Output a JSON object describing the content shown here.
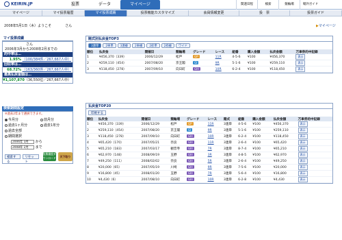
{
  "brand": {
    "logo_text": "KEIRIN.JP"
  },
  "topnav": [
    {
      "label": "投票"
    },
    {
      "label": "データ"
    },
    {
      "label": "マイページ"
    }
  ],
  "util": [
    "関連日程",
    "検索",
    "競輪場",
    "場外ガイド"
  ],
  "subnav": [
    {
      "label": "マイページ"
    },
    {
      "label": "マイ投票履歴"
    },
    {
      "label": "マイ投票成績"
    },
    {
      "label": "投票機能カスタマイズ"
    },
    {
      "label": "会員情報変更"
    },
    {
      "label": "投　票"
    },
    {
      "label": "投票ガイド"
    }
  ],
  "header": {
    "date_line": "2008年5月1日（木）ようこそ　　　　さん",
    "mypage_link": "マイページ"
  },
  "side": {
    "perf_title": "マイ投票成績",
    "perf_name_line": "さん",
    "perf_period": "2006年3月から2008年2月までの",
    "hit_rate_label": "的中率は…",
    "hit_rate_pct": "1.95%",
    "hit_rate_detail": "（100/384件／267,667人中）",
    "return_rate_label": "回収率は…",
    "return_rate_pct": "68.72%",
    "return_rate_detail": "（163/360件／267,667人中）",
    "max_payout_label": "最高払戻金額は…",
    "max_payout_val": "¥1,107,870",
    "max_payout_detail": "（36,550位／267,667人中）",
    "search_title": "検索期間設定",
    "search_note": "※過去2年まで選択できます。",
    "options": [
      {
        "label": "今月分",
        "on": true
      },
      {
        "label": "前月分",
        "on": false
      },
      {
        "label": "過去1ヶ月分",
        "on": false
      },
      {
        "label": "過去1年分",
        "on": false
      },
      {
        "label": "過去全部",
        "on": false
      },
      {
        "label": "期間選択",
        "on": false
      }
    ],
    "from_select": "2006年 3月",
    "until_label": "から",
    "to_select": "2008年 2月",
    "end_label": "まで",
    "btn_search": "検索する",
    "btn_reset": "リセット",
    "banner_label": "投票履歴ダウンロード",
    "banner2_label": "天下取り"
  },
  "top3": {
    "title": "賭式別払戻金TOP3",
    "tabs": [
      {
        "label": "3連単",
        "on": true
      },
      {
        "label": "2車単",
        "on": false
      },
      {
        "label": "3連複",
        "on": false
      },
      {
        "label": "2車複",
        "on": false
      },
      {
        "label": "2枠単",
        "on": false
      },
      {
        "label": "2枠複",
        "on": false
      },
      {
        "label": "ワイド",
        "on": false
      }
    ],
    "headers": [
      "順位",
      "払戻金",
      "開催日",
      "競輪場",
      "グレード",
      "レース",
      "組番",
      "購入金額",
      "払戻金額",
      "万車券的中記録"
    ],
    "rows": [
      {
        "rank": "1",
        "payout": "¥456,370（339）",
        "date": "2006/12/29",
        "track": "松戸",
        "grade": "GP",
        "race": "11R",
        "combo": "4-5-6",
        "buy": "¥100",
        "paid": "¥456,370",
        "rec": "表示"
      },
      {
        "rank": "2",
        "payout": "¥259,110（454）",
        "date": "2007/08/20",
        "track": "京王閣",
        "grade": "GI",
        "race": "9R",
        "combo": "5-1-6",
        "buy": "¥100",
        "paid": "¥259,110",
        "rec": "表示"
      },
      {
        "rank": "3",
        "payout": "¥118,450（278）",
        "date": "2007/09/10",
        "track": "向日町",
        "grade": "GIII",
        "race": "10R",
        "combo": "6-2-4",
        "buy": "¥100",
        "paid": "¥118,450",
        "rec": "表示"
      }
    ]
  },
  "top20": {
    "title": "払戻金TOP20",
    "print_btn": "印刷する",
    "headers": [
      "順位",
      "払戻金",
      "開催日",
      "競輪場",
      "グレード",
      "レース",
      "賭式",
      "組番",
      "購入金額",
      "払戻金額",
      "万車券的中記録"
    ],
    "rows": [
      {
        "rank": "1",
        "payout": "¥456,370（339）",
        "date": "2006/12/29",
        "track": "松戸",
        "grade": "GP",
        "race": "11R",
        "type": "3連単",
        "combo": "4-5-6",
        "buy": "¥100",
        "paid": "¥456,370",
        "rec": "表示"
      },
      {
        "rank": "2",
        "payout": "¥259,110（454）",
        "date": "2007/08/20",
        "track": "京王閣",
        "grade": "GI",
        "race": "9R",
        "type": "3連単",
        "combo": "5-1-6",
        "buy": "¥100",
        "paid": "¥259,110",
        "rec": "表示"
      },
      {
        "rank": "3",
        "payout": "¥118,450（278）",
        "date": "2007/09/10",
        "track": "向日町",
        "grade": "GIII",
        "race": "10R",
        "type": "3連単",
        "combo": "6-2-4",
        "buy": "¥100",
        "paid": "¥118,450",
        "rec": "表示"
      },
      {
        "rank": "4",
        "payout": "¥65,420（170）",
        "date": "2007/05/21",
        "track": "奈良",
        "grade": "GIII",
        "race": "11R",
        "type": "3連単",
        "combo": "2-6-4",
        "buy": "¥100",
        "paid": "¥65,420",
        "rec": "表示"
      },
      {
        "rank": "5",
        "payout": "¥65,210（183）",
        "date": "2007/03/17",
        "track": "観音寺",
        "grade": "GIII",
        "race": "7R",
        "type": "3連単",
        "combo": "8-7-4",
        "buy": "¥100",
        "paid": "¥65,210",
        "rec": "表示"
      },
      {
        "rank": "6",
        "payout": "¥62,970（148）",
        "date": "2008/09/19",
        "track": "玉野",
        "grade": "GIII",
        "race": "3R",
        "type": "3連単",
        "combo": "4-8-5",
        "buy": "¥100",
        "paid": "¥62,970",
        "rec": "表示"
      },
      {
        "rank": "7",
        "payout": "¥49,250（111）",
        "date": "2008/02/02",
        "track": "奈良",
        "grade": "GIII",
        "race": "5R",
        "type": "3連単",
        "combo": "2-6-4",
        "buy": "¥100",
        "paid": "¥49,250",
        "rec": "表示"
      },
      {
        "rank": "8",
        "payout": "¥20,000（65）",
        "date": "2007/05/19",
        "track": "川崎",
        "grade": "GIII",
        "race": "9R",
        "type": "3連単",
        "combo": "7-5-6",
        "buy": "¥100",
        "paid": "¥20,000",
        "rec": "表示"
      },
      {
        "rank": "9",
        "payout": "¥16,800（45）",
        "date": "2008/01/20",
        "track": "玉野",
        "grade": "GIII",
        "race": "7R",
        "type": "3連単",
        "combo": "5-6-4",
        "buy": "¥100",
        "paid": "¥16,800",
        "rec": "表示"
      },
      {
        "rank": "10",
        "payout": "¥4,430（6）",
        "date": "2007/08/10",
        "track": "向日町",
        "grade": "GIII",
        "race": "10R",
        "type": "3連単",
        "combo": "6-2-8",
        "buy": "¥100",
        "paid": "¥4,430",
        "rec": "表示"
      }
    ]
  }
}
